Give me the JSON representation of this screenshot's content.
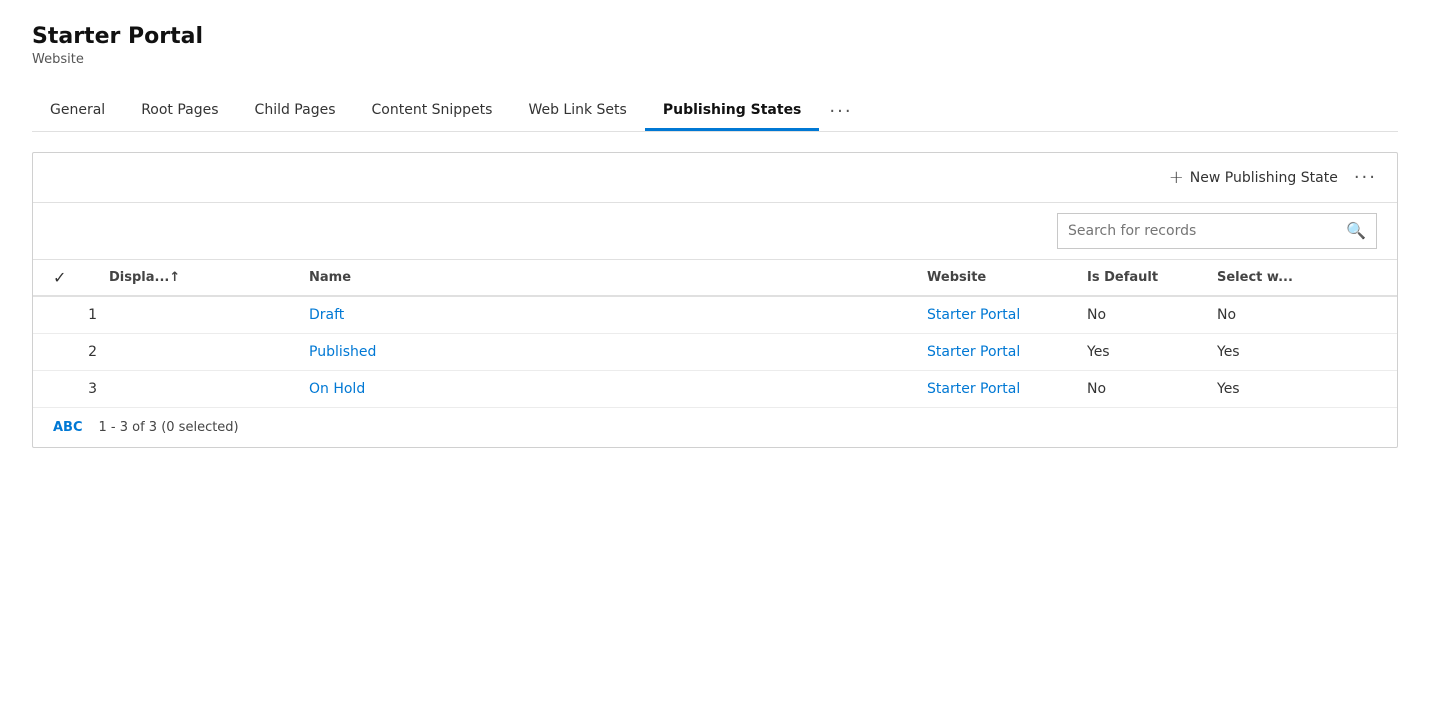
{
  "header": {
    "title": "Starter Portal",
    "subtitle": "Website"
  },
  "tabs": [
    {
      "id": "general",
      "label": "General",
      "active": false
    },
    {
      "id": "root-pages",
      "label": "Root Pages",
      "active": false
    },
    {
      "id": "child-pages",
      "label": "Child Pages",
      "active": false
    },
    {
      "id": "content-snippets",
      "label": "Content Snippets",
      "active": false
    },
    {
      "id": "web-link-sets",
      "label": "Web Link Sets",
      "active": false
    },
    {
      "id": "publishing-states",
      "label": "Publishing States",
      "active": true
    }
  ],
  "toolbar": {
    "new_button_label": "New Publishing State",
    "more_label": "···"
  },
  "search": {
    "placeholder": "Search for records"
  },
  "table": {
    "columns": [
      {
        "id": "check",
        "label": "✓"
      },
      {
        "id": "display",
        "label": "Displa...↑"
      },
      {
        "id": "name",
        "label": "Name"
      },
      {
        "id": "website",
        "label": "Website"
      },
      {
        "id": "is_default",
        "label": "Is Default"
      },
      {
        "id": "select_w",
        "label": "Select w..."
      }
    ],
    "rows": [
      {
        "num": "1",
        "name": "Draft",
        "website": "Starter Portal",
        "is_default": "No",
        "select_w": "No"
      },
      {
        "num": "2",
        "name": "Published",
        "website": "Starter Portal",
        "is_default": "Yes",
        "select_w": "Yes"
      },
      {
        "num": "3",
        "name": "On Hold",
        "website": "Starter Portal",
        "is_default": "No",
        "select_w": "Yes"
      }
    ]
  },
  "footer": {
    "abc_label": "ABC",
    "count_label": "1 - 3 of 3 (0 selected)"
  },
  "icons": {
    "plus": "+",
    "search": "🔍",
    "more": "···",
    "check": "✓",
    "sort_asc": "↑"
  },
  "colors": {
    "accent": "#0078d4",
    "tab_active_border": "#0078d4"
  }
}
